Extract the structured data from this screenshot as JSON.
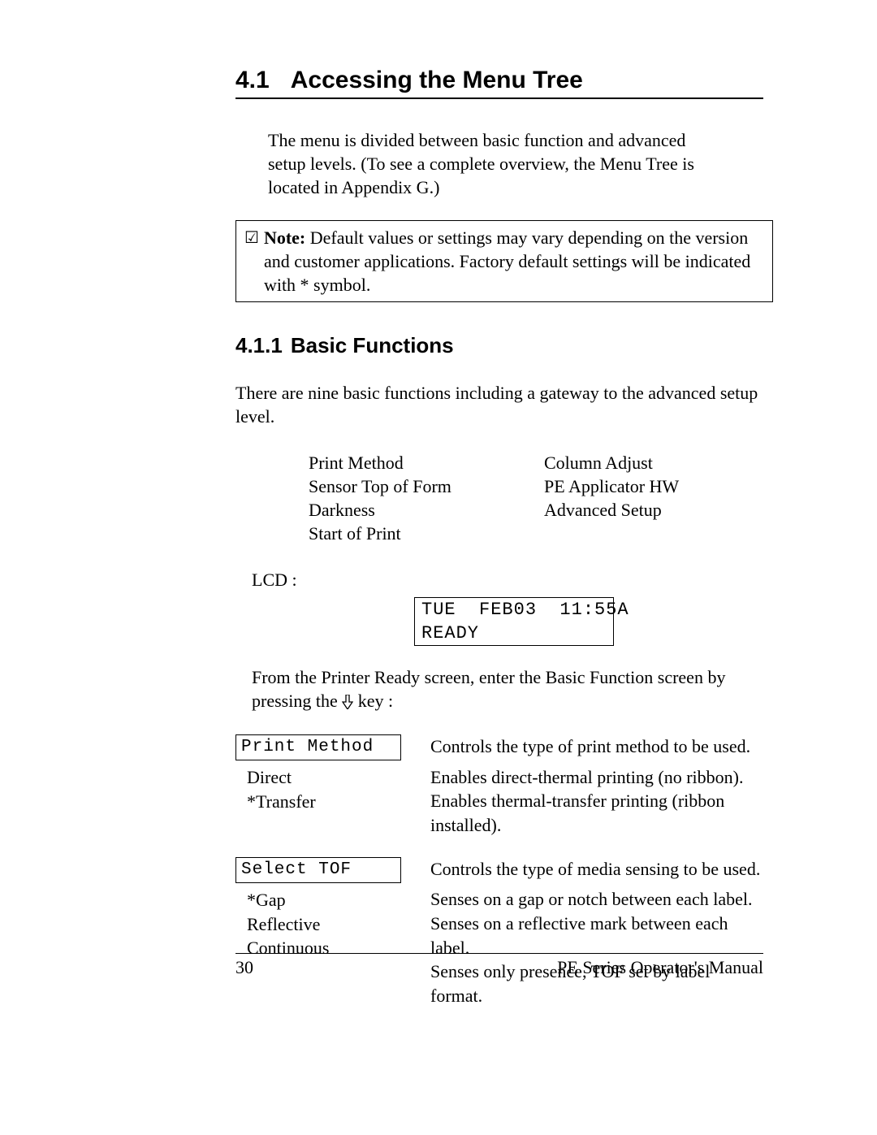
{
  "section": {
    "number": "4.1",
    "title": "Accessing the Menu Tree"
  },
  "intro_para": "The menu is divided between basic function and advanced setup levels.  (To see a complete overview, the Menu Tree is located in Appendix G.)",
  "note": {
    "label": "Note:",
    "text": "Default values or settings may vary depending on the version and customer applications.  Factory default settings will be indicated with * symbol."
  },
  "sub": {
    "number": "4.1.1",
    "title": "Basic Functions"
  },
  "sub_intro": "There are nine basic functions including a gateway to the advanced setup level.",
  "functions_col1": [
    "Print Method",
    "Sensor Top of Form",
    "Darkness",
    "Start of Print"
  ],
  "functions_col2": [
    "Column Adjust",
    "PE Applicator HW",
    "Advanced Setup"
  ],
  "lcd_label": "LCD :",
  "lcd": {
    "line1": "TUE  FEB03  11:55A",
    "line2": "READY"
  },
  "from_text_a": "From the Printer Ready screen, enter the Basic Function screen by pressing the ",
  "from_text_b": " key :",
  "config": [
    {
      "head": "Print Method",
      "head_desc": "Controls the type of print method to be used.",
      "opts": [
        {
          "name": "Direct",
          "desc": "Enables direct-thermal printing (no ribbon)."
        },
        {
          "name": "*Transfer",
          "desc": "Enables thermal-transfer printing (ribbon installed)."
        }
      ]
    },
    {
      "head": "Select TOF",
      "head_desc": "Controls the type of media sensing to be used.",
      "opts": [
        {
          "name": "*Gap",
          "desc": "Senses on a gap or notch between each label."
        },
        {
          "name": "Reflective",
          "desc": "Senses on a reflective mark between each label."
        },
        {
          "name": "Continuous",
          "desc": "Senses only presence, TOF set by label format."
        }
      ]
    }
  ],
  "footer": {
    "page": "30",
    "manual": "PE Series Operator's Manual"
  }
}
